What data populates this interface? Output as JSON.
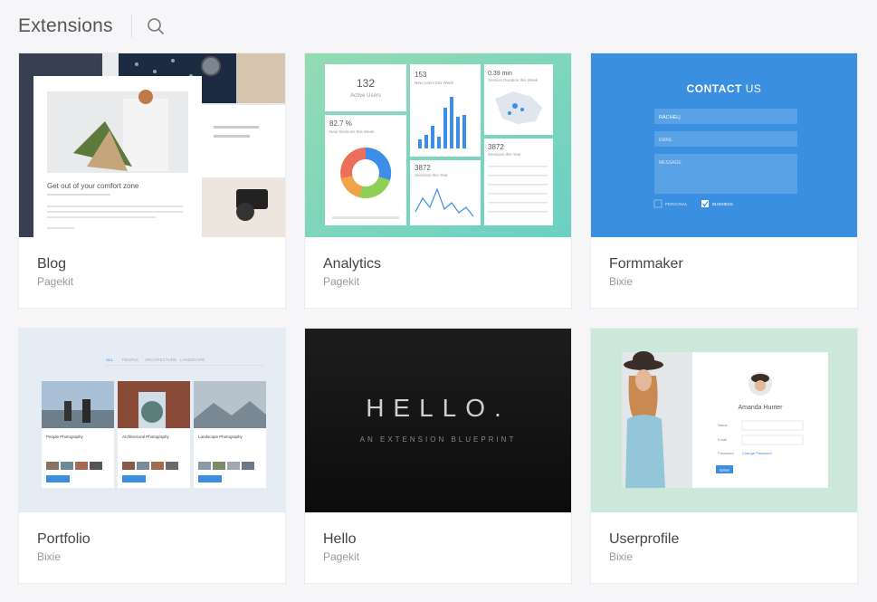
{
  "header": {
    "title": "Extensions"
  },
  "cards": [
    {
      "name": "Blog",
      "author": "Pagekit",
      "preview": {
        "headline": "Get out of your comfort zone"
      }
    },
    {
      "name": "Analytics",
      "author": "Pagekit",
      "preview": {
        "active_users_value": "132",
        "active_users_label": "Active Users",
        "new_users_value": "153",
        "new_users_label": "New Users this Week",
        "session_duration_value": "0.39 min",
        "session_duration_label": "Session Duration this Week",
        "new_sessions_value": "82.7 %",
        "new_sessions_label": "New Sessions this Week",
        "sessions_year_value": "3872",
        "sessions_year_label": "Sessions this Year",
        "sessions_year_value_2": "3872",
        "sessions_year_label_2": "Sessions this Year"
      }
    },
    {
      "name": "Formmaker",
      "author": "Bixie",
      "preview": {
        "title_bold": "CONTACT",
        "title_rest": "US",
        "field_name": "RACHEL|",
        "field_email": "EMAIL",
        "field_message": "MESSAGE",
        "option_1": "PERSONAL",
        "option_2": "BUSINESS"
      }
    },
    {
      "name": "Portfolio",
      "author": "Bixie",
      "preview": {
        "tabs": [
          "ALL",
          "PEOPLE",
          "ARCHITECTURE",
          "LANDSCAPE"
        ],
        "items": [
          "People Photography",
          "Architectural Photography",
          "Landscape Photography"
        ]
      }
    },
    {
      "name": "Hello",
      "author": "Pagekit",
      "preview": {
        "headline": "HELLO.",
        "subline": "AN EXTENSION BLUEPRINT"
      }
    },
    {
      "name": "Userprofile",
      "author": "Bixie",
      "preview": {
        "user_name": "Amanda Hunter",
        "label_name": "Name",
        "label_email": "Email",
        "label_password": "Password",
        "change_password": "Change Password",
        "button": "Update"
      }
    }
  ]
}
